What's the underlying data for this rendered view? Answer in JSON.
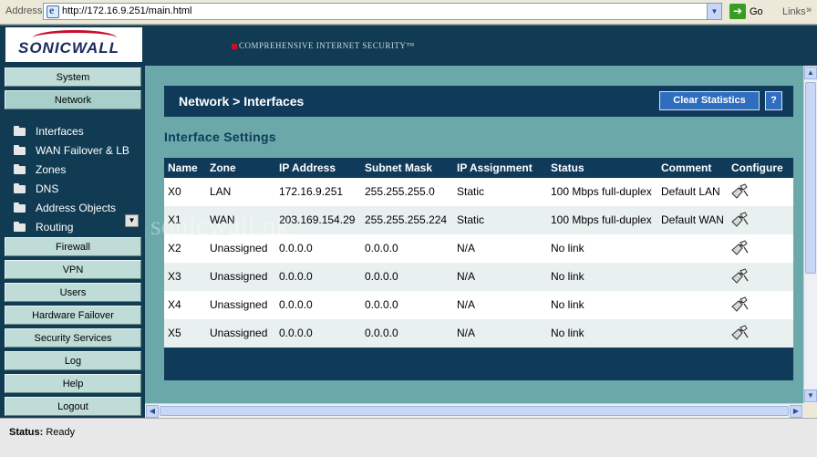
{
  "browser": {
    "address_label": "Address",
    "url": "http://172.16.9.251/main.html",
    "go_label": "Go",
    "links_label": "Links"
  },
  "header": {
    "logo": "SONICWALL",
    "tagline": "COMPREHENSIVE INTERNET SECURITY™"
  },
  "sidebar": {
    "top_items": [
      {
        "label": "System"
      },
      {
        "label": "Network"
      }
    ],
    "sub_items": [
      {
        "label": "Interfaces",
        "icon": "folder-open-icon"
      },
      {
        "label": "WAN Failover & LB",
        "icon": "folder-icon"
      },
      {
        "label": "Zones",
        "icon": "folder-icon"
      },
      {
        "label": "DNS",
        "icon": "folder-icon"
      },
      {
        "label": "Address Objects",
        "icon": "folder-icon"
      },
      {
        "label": "Routing",
        "icon": "folder-icon"
      }
    ],
    "bottom_items": [
      {
        "label": "Firewall"
      },
      {
        "label": "VPN"
      },
      {
        "label": "Users"
      },
      {
        "label": "Hardware Failover"
      },
      {
        "label": "Security Services"
      },
      {
        "label": "Log"
      },
      {
        "label": "Help"
      },
      {
        "label": "Logout"
      }
    ]
  },
  "page": {
    "title": "Network > Interfaces",
    "clear_stats_label": "Clear Statistics",
    "help_label": "?",
    "section_title": "Interface Settings"
  },
  "table": {
    "headers": [
      "Name",
      "Zone",
      "IP Address",
      "Subnet Mask",
      "IP Assignment",
      "Status",
      "Comment",
      "Configure"
    ],
    "rows": [
      {
        "name": "X0",
        "zone": "LAN",
        "ip": "172.16.9.251",
        "mask": "255.255.255.0",
        "assignment": "Static",
        "status": "100 Mbps full-duplex",
        "comment": "Default LAN"
      },
      {
        "name": "X1",
        "zone": "WAN",
        "ip": "203.169.154.29",
        "mask": "255.255.255.224",
        "assignment": "Static",
        "status": "100 Mbps full-duplex",
        "comment": "Default WAN"
      },
      {
        "name": "X2",
        "zone": "Unassigned",
        "ip": "0.0.0.0",
        "mask": "0.0.0.0",
        "assignment": "N/A",
        "status": "No link",
        "comment": ""
      },
      {
        "name": "X3",
        "zone": "Unassigned",
        "ip": "0.0.0.0",
        "mask": "0.0.0.0",
        "assignment": "N/A",
        "status": "No link",
        "comment": ""
      },
      {
        "name": "X4",
        "zone": "Unassigned",
        "ip": "0.0.0.0",
        "mask": "0.0.0.0",
        "assignment": "N/A",
        "status": "No link",
        "comment": ""
      },
      {
        "name": "X5",
        "zone": "Unassigned",
        "ip": "0.0.0.0",
        "mask": "0.0.0.0",
        "assignment": "N/A",
        "status": "No link",
        "comment": ""
      }
    ]
  },
  "watermark": "sonicwall.nk",
  "status": {
    "label": "Status:",
    "value": "Ready"
  },
  "colors": {
    "header_bg": "#103b52",
    "title_bar_bg": "#0f3a5a",
    "content_bg": "#6aa8aa",
    "nav_button_bg": "#bfdcd8",
    "action_button_bg": "#2f6dbf"
  }
}
